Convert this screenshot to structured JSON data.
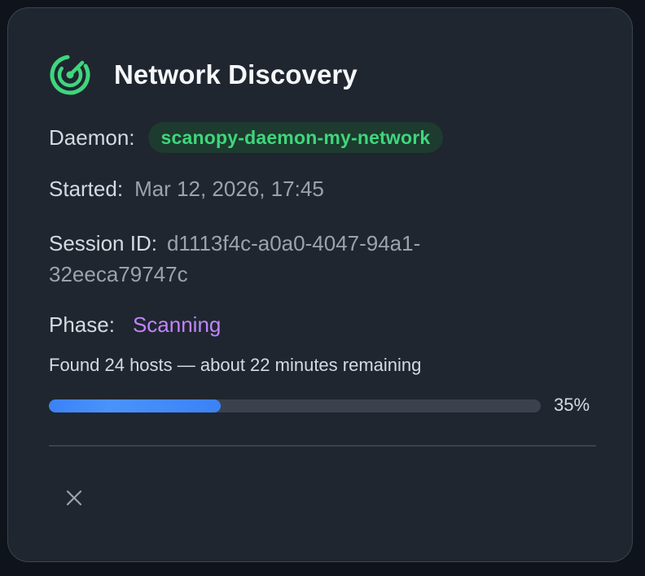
{
  "card": {
    "title": "Network Discovery",
    "icon": "radar-icon",
    "daemon": {
      "label": "Daemon:",
      "value": "scanopy-daemon-my-network"
    },
    "started": {
      "label": "Started:",
      "value": "Mar 12, 2026, 17:45"
    },
    "session": {
      "label": "Session ID:",
      "value": "d1113f4c-a0a0-4047-94a1-32eeca79747c"
    },
    "phase": {
      "label": "Phase:",
      "value": "Scanning"
    },
    "status_text": "Found 24 hosts — about 22 minutes remaining",
    "progress": {
      "percent": 35,
      "label": "35%"
    },
    "close_icon": "close-icon"
  },
  "colors": {
    "background": "#0f141c",
    "card": "#1f2630",
    "accent_green": "#3fd67d",
    "phase_purple": "#c084fc",
    "progress_blue": "#3b82f6"
  }
}
